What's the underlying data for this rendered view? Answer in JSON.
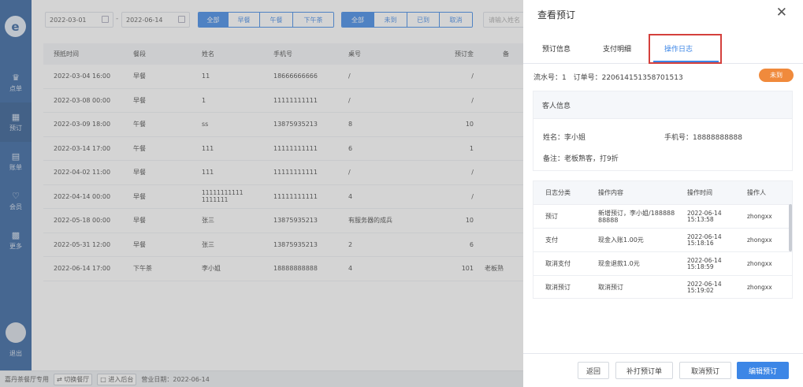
{
  "sidebar": {
    "logo": "e",
    "items": [
      {
        "icon": "crown-icon",
        "glyph": "♛",
        "label": "点单"
      },
      {
        "icon": "calendar-icon",
        "glyph": "▦",
        "label": "预订"
      },
      {
        "icon": "chart-icon",
        "glyph": "▤",
        "label": "账单"
      },
      {
        "icon": "member-icon",
        "glyph": "♡",
        "label": "会员"
      },
      {
        "icon": "grid-icon",
        "glyph": "▩",
        "label": "更多"
      }
    ],
    "logout": "退出"
  },
  "filters": {
    "start_date": "2022-03-01",
    "end_date": "2022-06-14",
    "dash": "-",
    "meal": [
      "全部",
      "早餐",
      "午餐",
      "下午茶"
    ],
    "status": [
      "全部",
      "未到",
      "已到",
      "取消"
    ],
    "search_placeholder": "请输入姓名"
  },
  "table": {
    "headers": [
      "预抵时间",
      "餐段",
      "姓名",
      "手机号",
      "桌号",
      "预订金",
      "备"
    ],
    "rows": [
      [
        "2022-03-04 16:00",
        "早餐",
        "11",
        "18666666666",
        "/",
        "/",
        ""
      ],
      [
        "2022-03-08 00:00",
        "早餐",
        "1",
        "11111111111",
        "/",
        "/",
        ""
      ],
      [
        "2022-03-09 18:00",
        "午餐",
        "ss",
        "13875935213",
        "8",
        "10",
        ""
      ],
      [
        "2022-03-14 17:00",
        "午餐",
        "111",
        "11111111111",
        "6",
        "1",
        ""
      ],
      [
        "2022-04-02 11:00",
        "早餐",
        "111",
        "11111111111",
        "/",
        "/",
        ""
      ],
      [
        "2022-04-14 00:00",
        "早餐",
        "111111111111111111",
        "11111111111",
        "4",
        "/",
        ""
      ],
      [
        "2022-05-18 00:00",
        "早餐",
        "张三",
        "13875935213",
        "有服务器的成兵",
        "10",
        ""
      ],
      [
        "2022-05-31 12:00",
        "早餐",
        "张三",
        "13875935213",
        "2",
        "6",
        ""
      ],
      [
        "2022-06-14 17:00",
        "下午茶",
        "李小姐",
        "18888888888",
        "4",
        "101",
        "老板熟"
      ]
    ]
  },
  "statusbar": {
    "shop": "嘉丹茶餐厅专用",
    "switch_btn": "切换餐厅",
    "enter_btn": "进入后台",
    "biz_date": "营业日期：2022-06-14"
  },
  "drawer": {
    "title": "查看预订",
    "tabs": [
      "预订信息",
      "支付明细",
      "操作日志"
    ],
    "active_tab": 2,
    "serial_label": "流水号：1",
    "order_label": "订单号：220614151358701513",
    "status_badge": "未到",
    "customer": {
      "heading": "客人信息",
      "name": "姓名：李小姐",
      "phone": "手机号：18888888888",
      "note": "备注：老板熟客，打9折"
    },
    "log": {
      "headers": [
        "日志分类",
        "操作内容",
        "操作时间",
        "操作人"
      ],
      "rows": [
        {
          "type": "预订",
          "content": "新增预订，李小姐/18888888888",
          "date": "2022-06-14",
          "time": "15:13:58",
          "user": "zhongxx"
        },
        {
          "type": "支付",
          "content": "现金入账1.00元",
          "date": "2022-06-14",
          "time": "15:18:16",
          "user": "zhongxx"
        },
        {
          "type": "取消支付",
          "content": "现金退款1.0元",
          "date": "2022-06-14",
          "time": "15:18:59",
          "user": "zhongxx"
        },
        {
          "type": "取消预订",
          "content": "取消预订",
          "date": "2022-06-14",
          "time": "15:19:02",
          "user": "zhongxx"
        }
      ]
    },
    "buttons": {
      "back": "返回",
      "reprint": "补打预订单",
      "cancel": "取消预订",
      "edit": "编辑预订"
    }
  },
  "colors": {
    "sidebar": "#2f5f9c",
    "primary": "#3c86e6",
    "badge": "#f08a3c",
    "highlight": "#d4403c"
  }
}
